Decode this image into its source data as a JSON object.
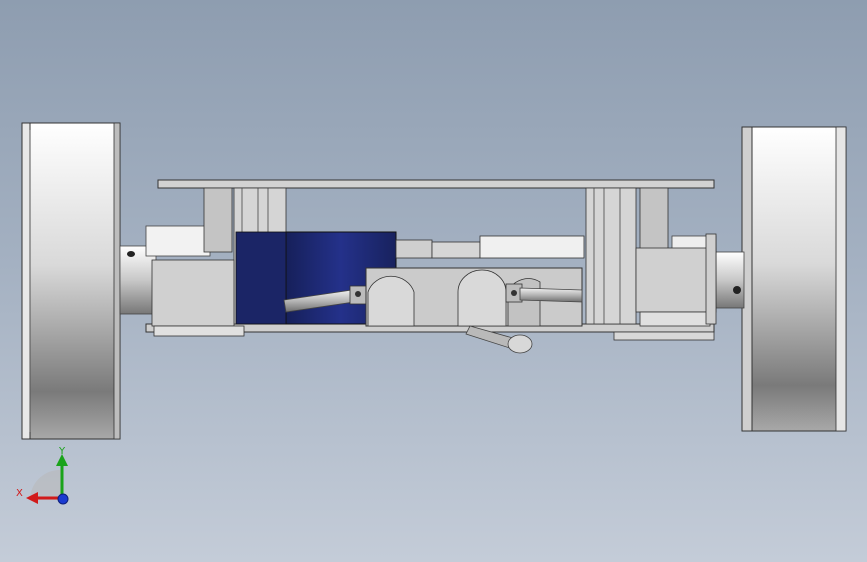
{
  "viewport": {
    "background_top": "#8e9db0",
    "background_bottom": "#c4ccd8"
  },
  "model": {
    "wheel_face_color": "#d8d8d8",
    "frame_color": "#c9c9c9",
    "motor_color": "#1f2a6b",
    "edge_color": "#333333"
  },
  "triad": {
    "x_label": "X",
    "y_label": "Y",
    "x_color": "#d11a1a",
    "y_color": "#1aa31a",
    "z_color": "#1a3ad1"
  }
}
